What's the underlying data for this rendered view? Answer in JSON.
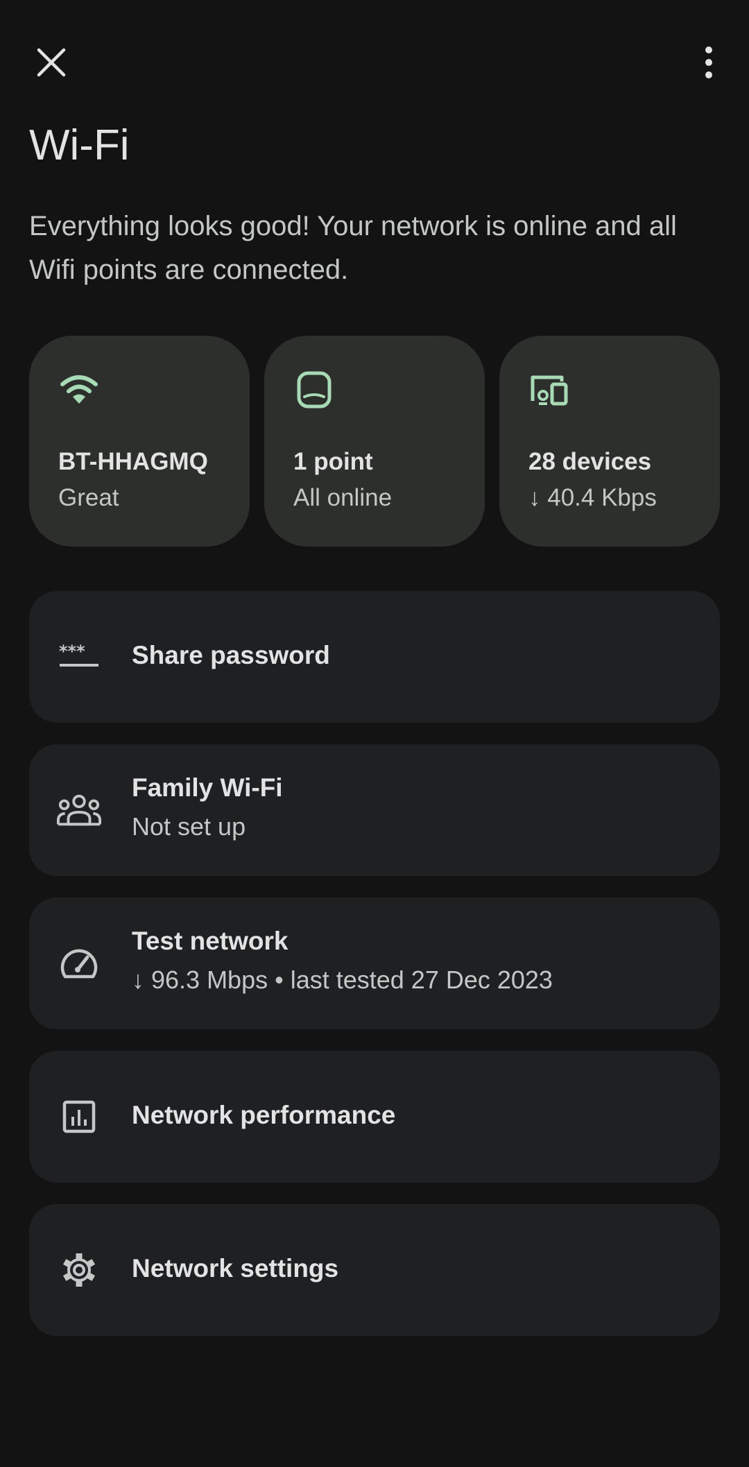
{
  "header": {
    "close_icon": "close-icon",
    "more_icon": "more-vert-icon"
  },
  "page": {
    "title": "Wi-Fi",
    "description": "Everything looks good! Your network is online and all Wifi points are connected."
  },
  "tiles": [
    {
      "icon": "wifi-icon",
      "title": "BT-HHAGMQ",
      "subtitle": "Great"
    },
    {
      "icon": "wifi-point-icon",
      "title": "1 point",
      "subtitle": "All online"
    },
    {
      "icon": "devices-icon",
      "title": "28 devices",
      "subtitle": "↓ 40.4 Kbps"
    }
  ],
  "menu": [
    {
      "icon": "password-icon",
      "title": "Share password"
    },
    {
      "icon": "family-icon",
      "title": "Family Wi-Fi",
      "subtitle": "Not set up"
    },
    {
      "icon": "speed-test-icon",
      "title": "Test network",
      "subtitle": "↓ 96.3 Mbps • last tested 27 Dec 2023"
    },
    {
      "icon": "performance-chart-icon",
      "title": "Network performance"
    },
    {
      "icon": "settings-gear-icon",
      "title": "Network settings"
    }
  ],
  "colors": {
    "background": "#131314",
    "tile_background": "#2d2f2d",
    "card_background": "#1f2022",
    "accent_green": "#a8dab5",
    "text_primary": "#e3e3e3",
    "text_secondary": "#c4c7c5"
  }
}
